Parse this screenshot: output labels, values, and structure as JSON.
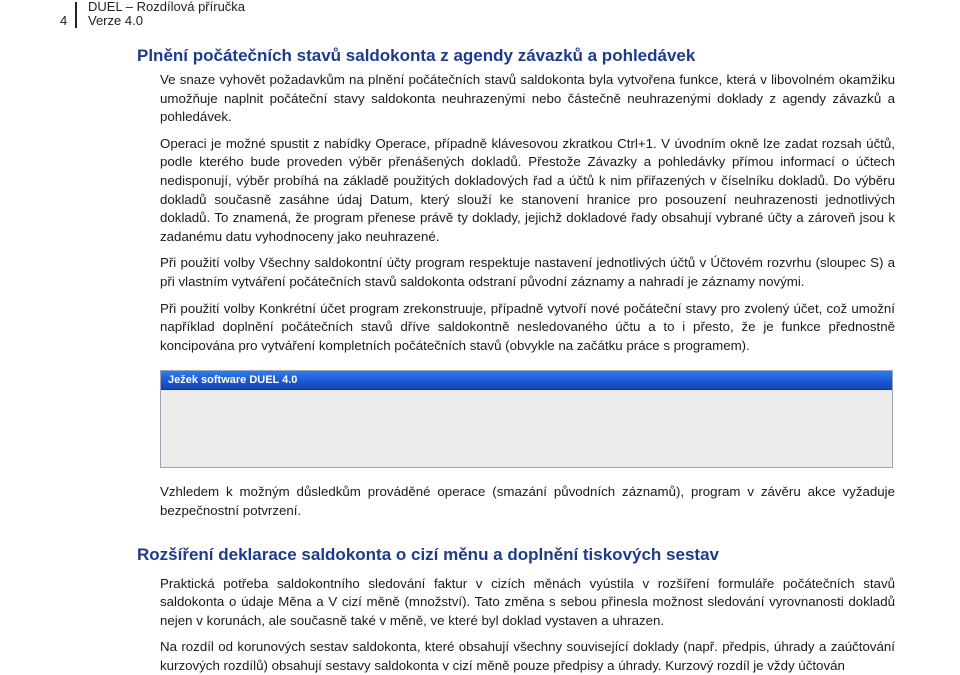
{
  "header": {
    "page_number": "4",
    "title": "DUEL – Rozdílová příručka",
    "version": "Verze 4.0"
  },
  "section1": {
    "heading": "Plnění počátečních stavů saldokonta z agendy závazků a pohledávek",
    "paragraphs": [
      "Ve snaze vyhovět požadavkům na plnění počátečních stavů saldokonta byla vytvořena funkce, která v libovolném okamžiku umožňuje naplnit počáteční stavy saldokonta neuhrazenými nebo částečně neuhrazenými doklady z agendy závazků a pohledávek.",
      "Operaci je možné spustit z nabídky Operace, případně klávesovou zkratkou Ctrl+1. V úvodním okně lze zadat rozsah účtů, podle kterého bude proveden výběr přenášených dokladů. Přestože Závazky a pohledávky přímou informací o účtech nedisponují, výběr probíhá na základě použitých dokladových řad a účtů k nim přiřazených v číselníku dokladů. Do výběru dokladů současně zasáhne údaj Datum, který slouží ke stanovení hranice pro posouzení neuhrazenosti jednotlivých dokladů. To znamená, že program přenese právě ty doklady, jejichž dokladové řady obsahují vybrané účty a zároveň jsou k zadanému datu vyhodnoceny jako neuhrazené.",
      "Při použití volby Všechny saldokontní účty program respektuje nastavení jednotlivých účtů v Účtovém rozvrhu (sloupec S) a při vlastním vytváření počátečních stavů saldokonta odstraní původní záznamy a nahradí je záznamy novými.",
      "Při použití volby Konkrétní účet program zrekonstruuje, případně vytvoří nové počáteční stavy pro zvolený účet, což umožní například doplnění počátečních stavů dříve saldokontně nesledovaného účtu a to i přesto, že je funkce přednostně koncipována pro vytváření kompletních počátečních stavů (obvykle na začátku práce s programem)."
    ],
    "window_title": "Ježek software DUEL 4.0",
    "after_paragraph": "Vzhledem k možným důsledkům prováděné operace (smazání původních záznamů), program v závěru akce vyžaduje bezpečnostní potvrzení."
  },
  "section2": {
    "heading": "Rozšíření deklarace saldokonta o cizí měnu a doplnění tiskových sestav",
    "paragraphs": [
      "Praktická potřeba saldokontního sledování faktur v cizích měnách vyústila v rozšíření formuláře počátečních stavů saldokonta o údaje Měna a V cizí měně (množství). Tato změna s sebou přinesla možnost sledování vyrovnanosti dokladů nejen v korunách, ale současně také v měně, ve které byl doklad vystaven a uhrazen.",
      "Na rozdíl od korunových sestav saldokonta, které obsahují všechny související doklady (např. předpis, úhrady a zaúčtování kurzových rozdílů) obsahují sestavy saldokonta v cizí měně pouze předpisy a úhrady. Kurzový rozdíl je vždy účtován"
    ]
  }
}
